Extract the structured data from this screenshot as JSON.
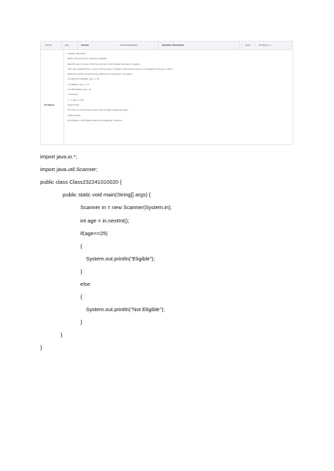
{
  "question_screenshot": {
    "header": {
      "course_label": "Course",
      "course_value": "Java",
      "session_label": "Session",
      "session_value": "Control statements",
      "info_label": "Question Information",
      "nav_label": "Level",
      "nav_value": "Conditions - 1"
    },
    "row_label": "Problem",
    "lines": [
      "Question description",
      "Write a Java program to determine eligibility.",
      "Read the age of a person from the input and check whether the person is eligible.",
      "If the age is greater than or equal to 25 the person is eligible, otherwise the person is not eligible for the given criteria.",
      "Write the program using the if-else statement as discussed in the session.",
      "Conditions for Eligibility: age >= 25",
      "1) If Eligible: Age >= 25",
      "2) If Not Eligible: Age < 25",
      "Constraints",
      "1 <= age <= 100",
      "Input Format",
      "The only line of input has a single value of integer representing age.",
      "Output Format",
      "Print Eligible or Not Eligible based on the eligibility conditions."
    ]
  },
  "code": [
    "import java.io.*;",
    "import java.util.Scanner;",
    "public class Class232241010020 {",
    "public static void main(String[] args) {",
    "Scanner in = new Scanner(System.in);",
    "int age = in.nextInt();",
    "if(age>=25)",
    "{",
    "System.out.println(\"Eligible\");",
    "}",
    "else",
    "{",
    "System.out.println(\"Not Eligible\");",
    "}",
    "}",
    "}"
  ]
}
